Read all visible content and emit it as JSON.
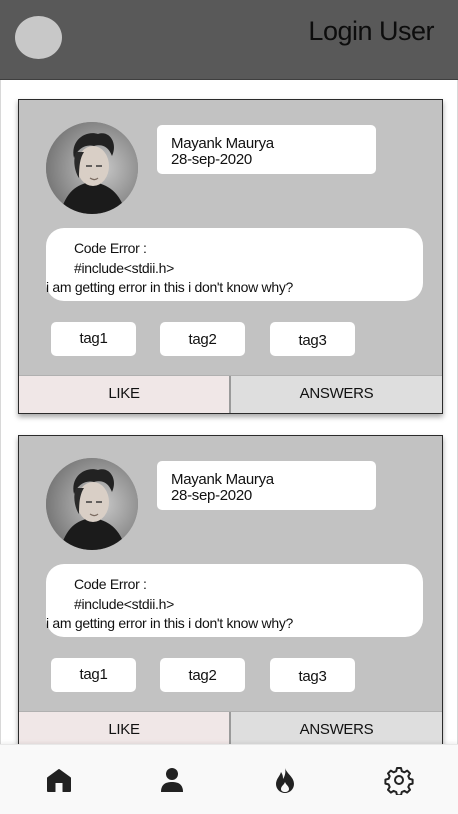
{
  "app_bar": {
    "title": "Login User"
  },
  "posts": [
    {
      "author_name": "Mayank Maurya",
      "date": "28-sep-2020",
      "question_lines": [
        "Code Error :",
        "#include<stdii.h>",
        "i am getting error in this i don't know why?"
      ],
      "tags": [
        "tag1",
        "tag2",
        "tag3"
      ],
      "like_label": "LIKE",
      "answers_label": "ANSWERS"
    },
    {
      "author_name": "Mayank Maurya",
      "date": "28-sep-2020",
      "question_lines": [
        "Code Error :",
        "#include<stdii.h>",
        "i am getting error in this i don't know why?"
      ],
      "tags": [
        "tag1",
        "tag2",
        "tag3"
      ],
      "like_label": "LIKE",
      "answers_label": "ANSWERS"
    }
  ],
  "bottom_nav": {
    "items": [
      {
        "icon": "home-icon"
      },
      {
        "icon": "person-icon"
      },
      {
        "icon": "flame-icon"
      },
      {
        "icon": "gear-icon"
      }
    ]
  },
  "colors": {
    "app_bar": "#595959",
    "card": "#c2c2c2",
    "like_button": "#f0e7e7",
    "answers_button": "#dedede"
  }
}
